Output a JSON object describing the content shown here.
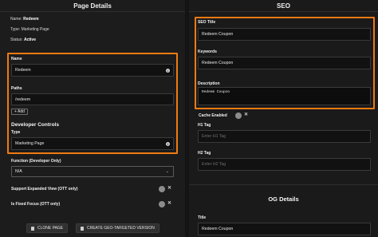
{
  "page_details": {
    "title": "Page Details",
    "meta": {
      "name_label": "Name:",
      "name_value": "Redeem",
      "type_label": "Type:",
      "type_value": "Marketing Page",
      "status_label": "Status:",
      "status_value": "Active"
    },
    "name": {
      "label": "Name",
      "value": "Redeem"
    },
    "paths": {
      "label": "Paths",
      "value": "/redeem",
      "add_label": "+ Add"
    },
    "developer_controls": {
      "heading": "Developer Controls",
      "type_label": "Type",
      "type_value": "Marketing Page"
    },
    "function": {
      "label": "Function (Developer Only)",
      "value": "N/A"
    },
    "support_expanded_view": {
      "label": "Support Expanded View (OTT only)",
      "value": false
    },
    "is_fixed_focus": {
      "label": "Is Fixed Focus (OTT only)",
      "value": false
    },
    "buttons": {
      "clone": "CLONE PAGE",
      "geo": "CREATE GEO-TARGETED VERSION"
    }
  },
  "seo": {
    "title": "SEO",
    "seo_title": {
      "label": "SEO Title",
      "value": "Redeem Coupon"
    },
    "keywords": {
      "label": "Keywords",
      "value": "Redeem Coupon"
    },
    "description": {
      "label": "Description",
      "value": "Redeem Coupon"
    },
    "cache_enabled": {
      "label": "Cache Enabled",
      "value": false
    },
    "h1": {
      "label": "H1 Tag",
      "placeholder": "Enter H1 Tag"
    },
    "h2": {
      "label": "H2 Tag",
      "placeholder": "Enter H2 Tag"
    }
  },
  "og": {
    "title": "OG Details",
    "og_title": {
      "label": "Title",
      "value": "Redeem Coupon"
    }
  },
  "colors": {
    "accent": "#f07a12",
    "background": "#1c1c1c"
  }
}
